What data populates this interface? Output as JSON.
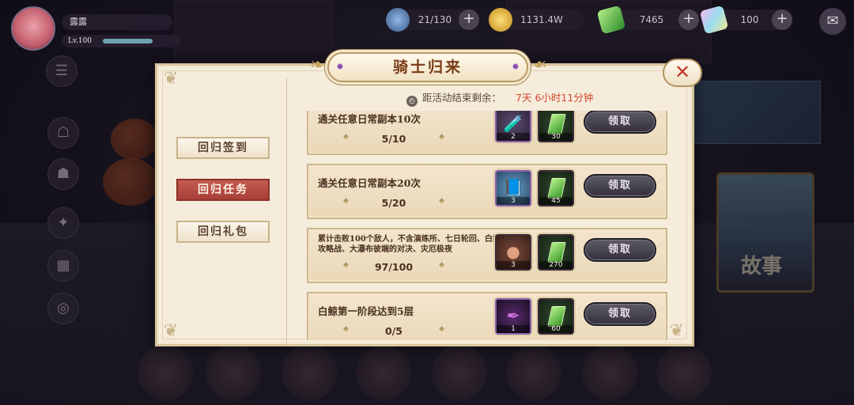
{
  "top_bar": {
    "player_name": "露露",
    "player_level": "Lv.100",
    "level_progress": 0.7,
    "stamina": "21/130",
    "gold": "1131.4W",
    "green_gem": "7465",
    "rainbow_gem": "100",
    "plus_symbol": "+",
    "mail_icon": "✉"
  },
  "modal": {
    "title": "骑士归来",
    "close_symbol": "✕",
    "timer_label": "距活动结束剩余：",
    "timer_value": "7天 6小时11分钟",
    "tabs": [
      {
        "label": "回归签到",
        "active": false
      },
      {
        "label": "回归任务",
        "active": true
      },
      {
        "label": "回归礼包",
        "active": false
      }
    ],
    "tasks": [
      {
        "name": "通关任意日常副本10次",
        "progress": "5/10",
        "rewards": [
          {
            "icon": "potion-icon",
            "qty": "2"
          },
          {
            "icon": "green-gem-icon",
            "qty": "30"
          }
        ],
        "claim_label": "领取"
      },
      {
        "name": "通关任意日常副本20次",
        "progress": "5/20",
        "rewards": [
          {
            "icon": "book-icon",
            "qty": "3"
          },
          {
            "icon": "green-gem-icon",
            "qty": "45"
          }
        ],
        "claim_label": "领取"
      },
      {
        "name": "累计击败100个敌人，不含演练所、七日轮回、白鲸攻略战、大瀑布彼端的对决、灾厄极夜",
        "progress": "97/100",
        "rewards": [
          {
            "icon": "coin-icon",
            "qty": "3"
          },
          {
            "icon": "green-gem-icon",
            "qty": "270"
          }
        ],
        "claim_label": "领取"
      },
      {
        "name": "白鲸第一阶段达到5层",
        "progress": "0/5",
        "rewards": [
          {
            "icon": "feather-icon",
            "qty": "1"
          },
          {
            "icon": "green-gem-icon",
            "qty": "60"
          }
        ],
        "claim_label": "领取"
      }
    ]
  },
  "background": {
    "story_label": "故事"
  }
}
